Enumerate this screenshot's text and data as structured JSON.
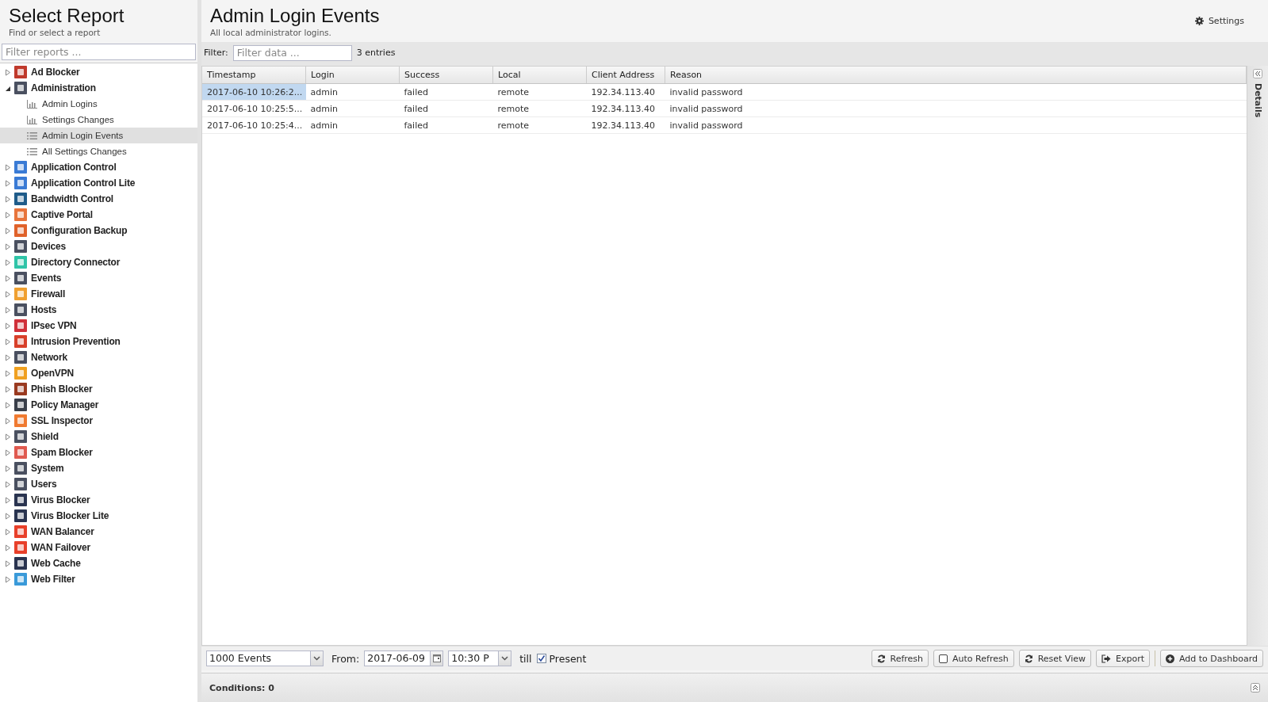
{
  "sidebar": {
    "title": "Select Report",
    "subtitle": "Find or select a report",
    "search": {
      "placeholder": "Filter reports ..."
    },
    "tree": [
      {
        "label": "Ad Blocker",
        "color": "#c0392b",
        "expanded": false,
        "selected": false
      },
      {
        "label": "Administration",
        "color": "#4a5060",
        "expanded": true,
        "selected": false,
        "children": [
          {
            "label": "Admin Logins",
            "kind": "chart",
            "selected": false
          },
          {
            "label": "Settings Changes",
            "kind": "chart",
            "selected": false
          },
          {
            "label": "Admin Login Events",
            "kind": "list",
            "selected": true
          },
          {
            "label": "All Settings Changes",
            "kind": "list",
            "selected": false
          }
        ]
      },
      {
        "label": "Application Control",
        "color": "#3a7bd5",
        "expanded": false,
        "selected": false
      },
      {
        "label": "Application Control Lite",
        "color": "#3a7bd5",
        "expanded": false,
        "selected": false
      },
      {
        "label": "Bandwidth Control",
        "color": "#1f5c8a",
        "expanded": false,
        "selected": false
      },
      {
        "label": "Captive Portal",
        "color": "#e8743b",
        "expanded": false,
        "selected": false
      },
      {
        "label": "Configuration Backup",
        "color": "#e0622a",
        "expanded": false,
        "selected": false
      },
      {
        "label": "Devices",
        "color": "#4a5060",
        "expanded": false,
        "selected": false
      },
      {
        "label": "Directory Connector",
        "color": "#2fc4a8",
        "expanded": false,
        "selected": false
      },
      {
        "label": "Events",
        "color": "#4a5060",
        "expanded": false,
        "selected": false
      },
      {
        "label": "Firewall",
        "color": "#f0a030",
        "expanded": false,
        "selected": false
      },
      {
        "label": "Hosts",
        "color": "#4a5060",
        "expanded": false,
        "selected": false
      },
      {
        "label": "IPsec VPN",
        "color": "#d0303a",
        "expanded": false,
        "selected": false
      },
      {
        "label": "Intrusion Prevention",
        "color": "#d8402a",
        "expanded": false,
        "selected": false
      },
      {
        "label": "Network",
        "color": "#4a5060",
        "expanded": false,
        "selected": false
      },
      {
        "label": "OpenVPN",
        "color": "#f0a020",
        "expanded": false,
        "selected": false
      },
      {
        "label": "Phish Blocker",
        "color": "#9a3a20",
        "expanded": false,
        "selected": false
      },
      {
        "label": "Policy Manager",
        "color": "#3a3f4a",
        "expanded": false,
        "selected": false
      },
      {
        "label": "SSL Inspector",
        "color": "#f07a30",
        "expanded": false,
        "selected": false
      },
      {
        "label": "Shield",
        "color": "#4a5060",
        "expanded": false,
        "selected": false
      },
      {
        "label": "Spam Blocker",
        "color": "#e05a50",
        "expanded": false,
        "selected": false
      },
      {
        "label": "System",
        "color": "#4a5060",
        "expanded": false,
        "selected": false
      },
      {
        "label": "Users",
        "color": "#4a5060",
        "expanded": false,
        "selected": false
      },
      {
        "label": "Virus Blocker",
        "color": "#2a3450",
        "expanded": false,
        "selected": false
      },
      {
        "label": "Virus Blocker Lite",
        "color": "#2a3450",
        "expanded": false,
        "selected": false
      },
      {
        "label": "WAN Balancer",
        "color": "#e8402a",
        "expanded": false,
        "selected": false
      },
      {
        "label": "WAN Failover",
        "color": "#e8402a",
        "expanded": false,
        "selected": false
      },
      {
        "label": "Web Cache",
        "color": "#2a3450",
        "expanded": false,
        "selected": false
      },
      {
        "label": "Web Filter",
        "color": "#3a9ad9",
        "expanded": false,
        "selected": false
      }
    ]
  },
  "header": {
    "title": "Admin Login Events",
    "subtitle": "All local administrator logins.",
    "settings": "Settings"
  },
  "filter": {
    "label": "Filter:",
    "placeholder": "Filter data ...",
    "count": "3 entries"
  },
  "table": {
    "columns": [
      "Timestamp",
      "Login",
      "Success",
      "Local",
      "Client Address",
      "Reason"
    ],
    "rows": [
      {
        "selected": true,
        "cells": [
          "2017-06-10 10:26:2...",
          "admin",
          "failed",
          "remote",
          "192.34.113.40",
          "invalid password"
        ]
      },
      {
        "selected": false,
        "cells": [
          "2017-06-10 10:25:5...",
          "admin",
          "failed",
          "remote",
          "192.34.113.40",
          "invalid password"
        ]
      },
      {
        "selected": false,
        "cells": [
          "2017-06-10 10:25:4...",
          "admin",
          "failed",
          "remote",
          "192.34.113.40",
          "invalid password"
        ]
      }
    ]
  },
  "details": {
    "label": "Details"
  },
  "toolbar": {
    "events": "1000 Events",
    "from_label": "From:",
    "date": "2017-06-09",
    "time": "10:30 P",
    "till_label": "till",
    "present": {
      "label": "Present",
      "checked": true
    },
    "refresh": "Refresh",
    "auto_refresh": {
      "label": "Auto Refresh",
      "checked": false
    },
    "buttons": [
      {
        "label": "Reset View",
        "kind": "reset"
      },
      {
        "label": "Export",
        "kind": "export"
      },
      {
        "label": "Add to Dashboard",
        "kind": "add"
      }
    ]
  },
  "conditions": "Conditions: 0"
}
